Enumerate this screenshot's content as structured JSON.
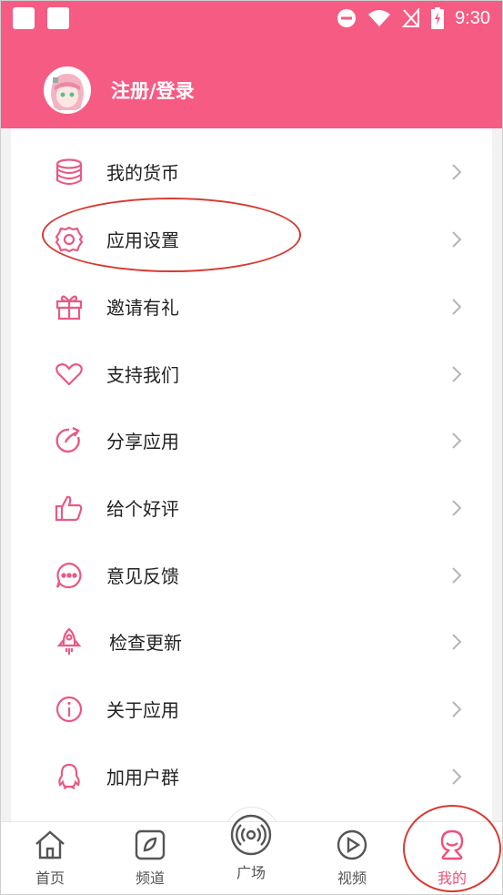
{
  "status_bar": {
    "time": "9:30"
  },
  "header": {
    "login_label": "注册/登录"
  },
  "colors": {
    "accent": "#f65b83",
    "icon": "#e85a84",
    "annotation": "#d63a32"
  },
  "menu": [
    {
      "label": "我的货币",
      "icon": "coins-icon"
    },
    {
      "label": "应用设置",
      "icon": "gear-icon"
    },
    {
      "label": "邀请有礼",
      "icon": "gift-icon"
    },
    {
      "label": "支持我们",
      "icon": "heart-icon"
    },
    {
      "label": "分享应用",
      "icon": "share-icon"
    },
    {
      "label": "给个好评",
      "icon": "thumbs-up-icon"
    },
    {
      "label": "意见反馈",
      "icon": "chat-icon"
    },
    {
      "label": "检查更新",
      "icon": "rocket-icon"
    },
    {
      "label": "关于应用",
      "icon": "info-icon"
    },
    {
      "label": "加用户群",
      "icon": "qq-icon"
    }
  ],
  "tabs": [
    {
      "label": "首页",
      "icon": "home-icon"
    },
    {
      "label": "频道",
      "icon": "channel-icon"
    },
    {
      "label": "广场",
      "icon": "broadcast-icon"
    },
    {
      "label": "视频",
      "icon": "play-icon"
    },
    {
      "label": "我的",
      "icon": "profile-icon",
      "active": true
    }
  ]
}
